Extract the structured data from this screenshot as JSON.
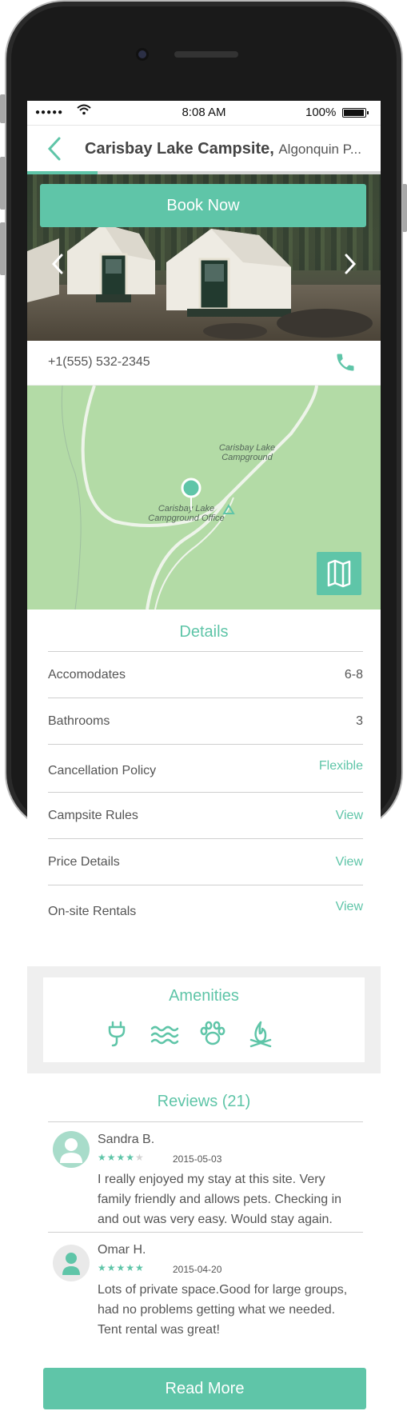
{
  "status_bar": {
    "signal": "●●●●●",
    "time": "8:08 AM",
    "battery": "100%"
  },
  "header": {
    "title": "Carisbay Lake Campsite,",
    "subtitle": "Algonquin P...",
    "progress": 0.2
  },
  "hero": {
    "book_label": "Book Now"
  },
  "contact": {
    "phone": "+1(555) 532-2345"
  },
  "map": {
    "label_campground": "Carisbay Lake\nCampground",
    "label_office": "Carisbay Lake\nCampground Office"
  },
  "details": {
    "title": "Details",
    "rows": [
      {
        "label": "Accomodates",
        "value": "6-8"
      },
      {
        "label": "Bathrooms",
        "value": "3"
      },
      {
        "label": "Cancellation Policy",
        "value": "Flexible"
      },
      {
        "label": "Campsite Rules",
        "value": "View"
      },
      {
        "label": "Price Details",
        "value": "View"
      },
      {
        "label": "On-site Rentals",
        "value": "View"
      }
    ]
  },
  "amenities": {
    "title": "Amenities",
    "icons": [
      "plug-icon",
      "water-icon",
      "paw-icon",
      "campfire-icon"
    ]
  },
  "reviews": {
    "title": "Reviews (21)",
    "items": [
      {
        "name": "Sandra B.",
        "rating": 4,
        "stars_on": "★★★★",
        "stars_off": "★",
        "date": "2015-05-03",
        "text": "I really enjoyed my stay at this site. Very family friendly and allows pets. Checking in and out was very easy. Would stay again."
      },
      {
        "name": "Omar H.",
        "rating": 5,
        "stars_on": "★★★★★",
        "stars_off": "",
        "date": "2015-04-20",
        "text": "Lots of private space.Good for large groups, had no problems getting what we needed. Tent rental was great!"
      }
    ],
    "read_more_label": "Read More"
  },
  "colors": {
    "accent": "#5fc5a8",
    "map": "#b3dba6"
  }
}
